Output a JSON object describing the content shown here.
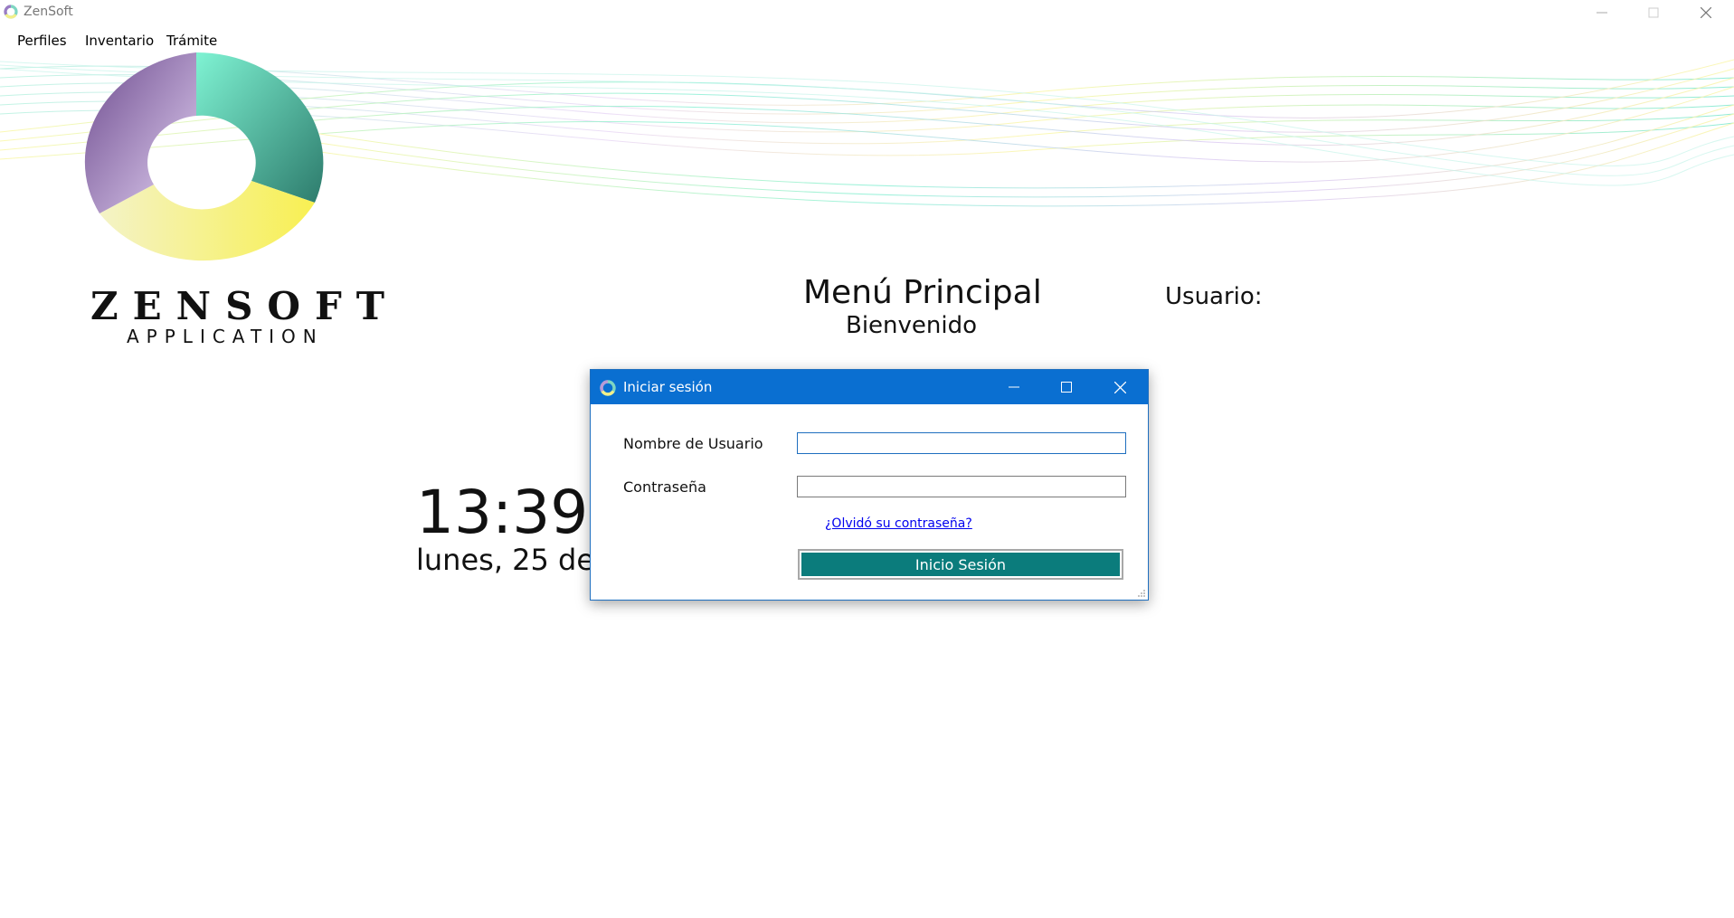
{
  "window": {
    "title": "ZenSoft",
    "controls": [
      "minimize-icon",
      "maximize-icon",
      "close-icon"
    ]
  },
  "menubar": {
    "items": [
      {
        "label": "Perfiles"
      },
      {
        "label": "Inventario"
      },
      {
        "label": "Trámite"
      }
    ]
  },
  "brand": {
    "name": "ZENSOFT",
    "subtitle": "APPLICATION"
  },
  "header": {
    "title": "Menú Principal",
    "subtitle": "Bienvenido",
    "user_label": "Usuario:"
  },
  "clock": {
    "time": "13:39",
    "date": "lunes, 25 de"
  },
  "login_dialog": {
    "title": "Iniciar sesión",
    "username_label": "Nombre de Usuario",
    "username_value": "",
    "password_label": "Contraseña",
    "password_value": "",
    "forgot_link": "¿Olvidó su contraseña?",
    "submit_label": "Inicio Sesión",
    "controls": [
      "minimize-icon",
      "maximize-icon",
      "close-icon"
    ]
  },
  "colors": {
    "dialog_titlebar": "#0a6fd1",
    "login_button": "#0b7c7c",
    "link": "#0000ee"
  }
}
